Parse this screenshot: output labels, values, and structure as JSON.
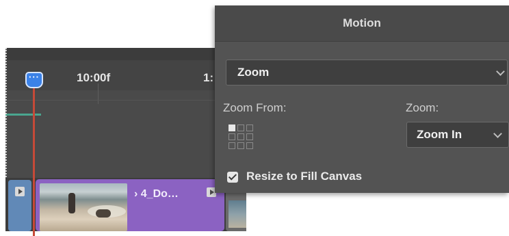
{
  "timeline": {
    "ruler_time": "10:00f",
    "ruler_time_cut": "1:",
    "playhead_glyph": "···",
    "clip_name": "› 4_Do…"
  },
  "motion_panel": {
    "title": "Motion",
    "preset": {
      "value": "Zoom"
    },
    "zoom_from_label": "Zoom From:",
    "zoom_label": "Zoom:",
    "zoom": {
      "value": "Zoom In"
    },
    "resize_label": "Resize to Fill Canvas",
    "resize_checked": true
  },
  "colors": {
    "panel_bg": "#535353",
    "clip_purple": "#8b62c2",
    "clip_blue": "#6189b7",
    "playhead": "#c64a38",
    "playhead_handle": "#3b82e8"
  }
}
